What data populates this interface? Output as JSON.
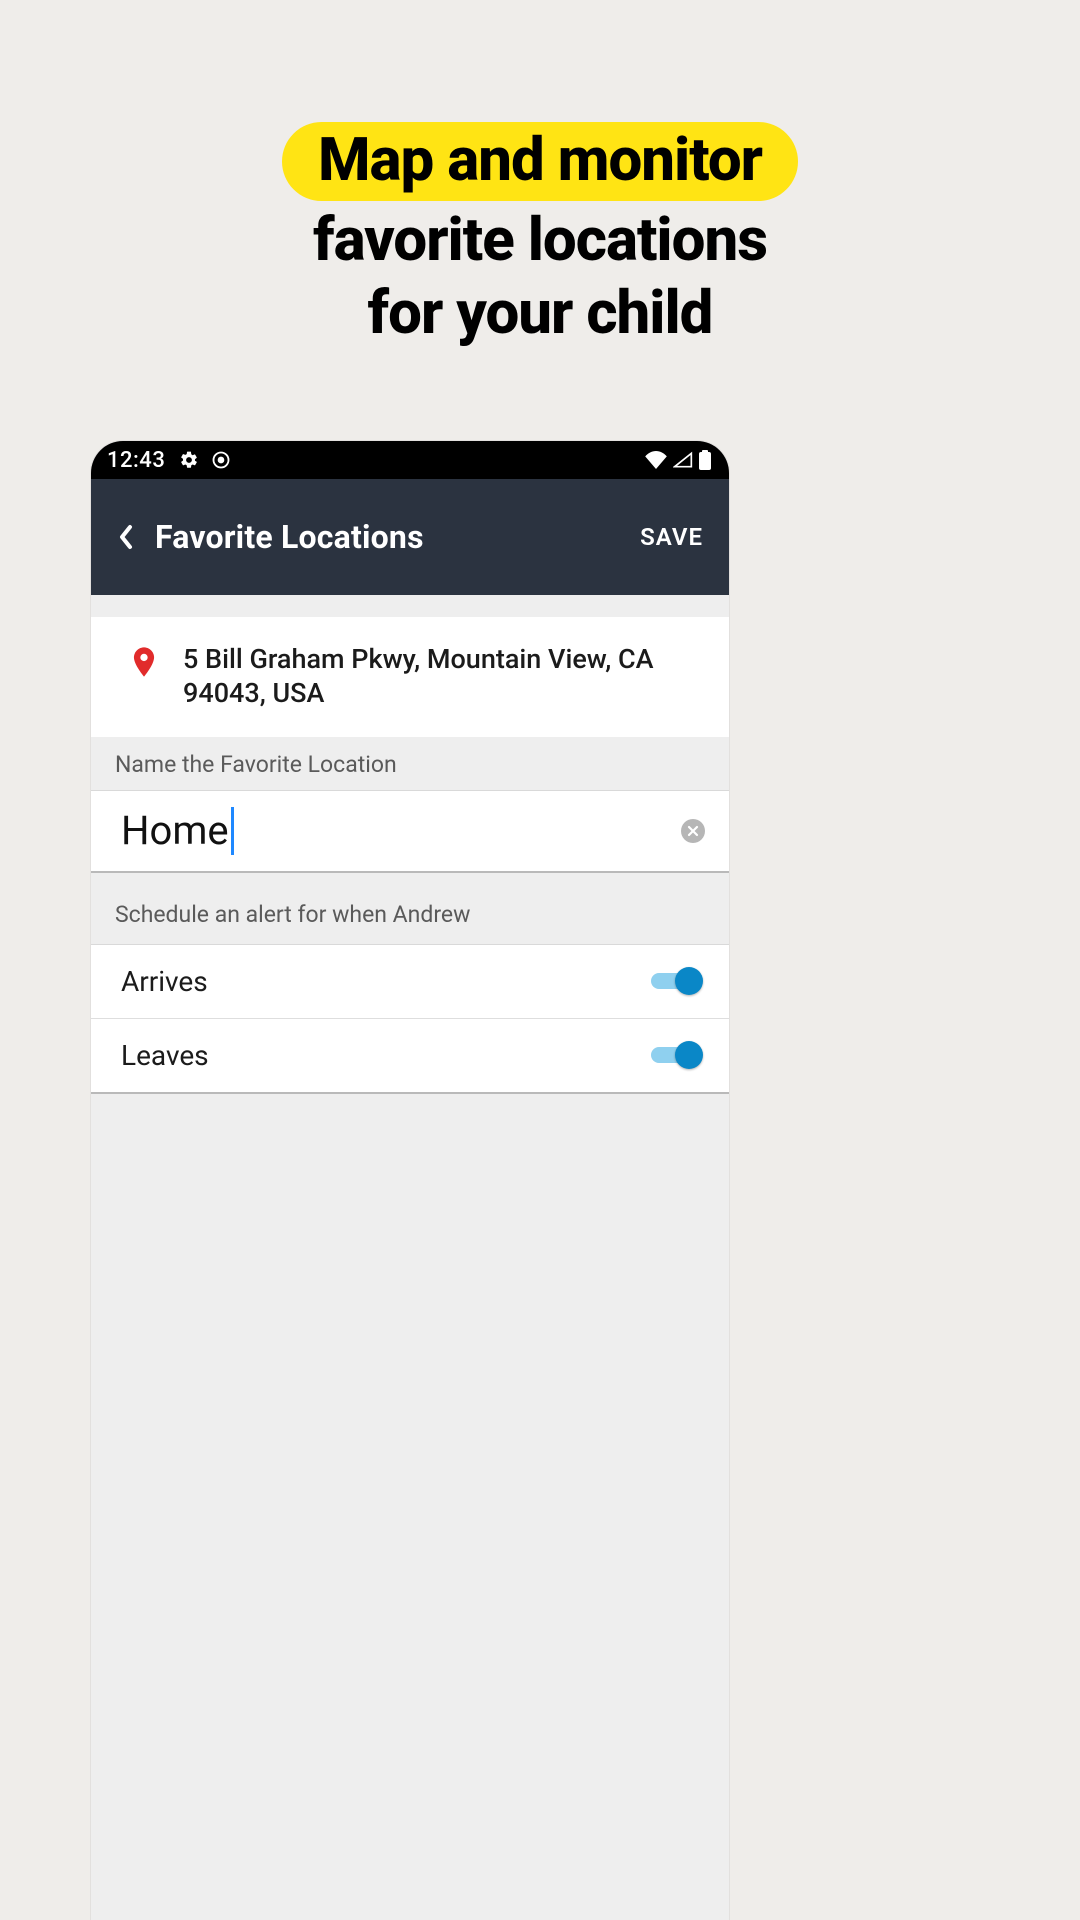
{
  "marketing": {
    "line1": "Map and monitor",
    "line2": "favorite locations",
    "line3": "for your child"
  },
  "status_bar": {
    "time": "12:43"
  },
  "app_bar": {
    "title": "Favorite Locations",
    "save_label": "SAVE"
  },
  "address": "5 Bill Graham Pkwy, Mountain View, CA 94043, USA",
  "name_section": {
    "label": "Name the Favorite Location",
    "value": "Home"
  },
  "alert_section": {
    "label": "Schedule an alert for when Andrew",
    "rows": [
      {
        "label": "Arrives",
        "on": true
      },
      {
        "label": "Leaves",
        "on": true
      }
    ]
  }
}
